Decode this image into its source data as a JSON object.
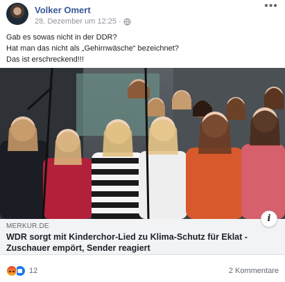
{
  "post": {
    "author": "Volker Omert",
    "timestamp": "28. Dezember um 12:25",
    "separator": "·",
    "privacy_icon": "globe-icon",
    "more_icon": "more-options-icon",
    "text_lines": [
      "Gab es sowas nicht in der DDR?",
      "Hat man das nicht als „Gehirnwäsche“ bezeichnet?",
      "Das ist erschreckend!!!"
    ]
  },
  "link_preview": {
    "domain": "MERKUR.DE",
    "title": "WDR sorgt mit Kinderchor-Lied zu Klima-Schutz für Eklat - Zuschauer empört, Sender reagiert",
    "info_icon": "i"
  },
  "engagement": {
    "reactions": [
      "angry-reaction-icon",
      "like-reaction-icon"
    ],
    "reaction_count": "12",
    "comments": "2 Kommentare"
  },
  "colors": {
    "author": "#385898",
    "secondary_text": "#90949c",
    "link_box_bg": "#f2f3f5",
    "like_blue": "#1877f2"
  }
}
